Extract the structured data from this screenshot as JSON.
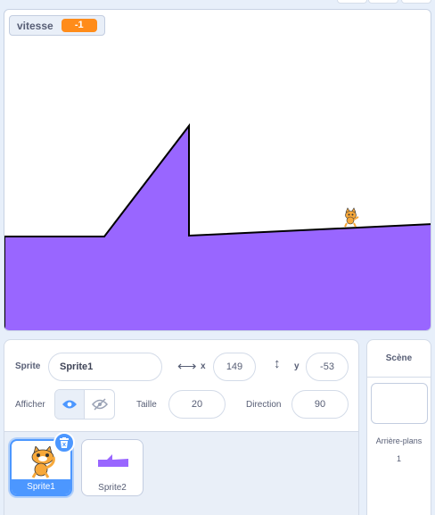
{
  "monitor": {
    "label": "vitesse",
    "value": "-1"
  },
  "sprite_info": {
    "sprite_label": "Sprite",
    "sprite_name": "Sprite1",
    "x_label": "x",
    "x_value": "149",
    "y_label": "y",
    "y_value": "-53",
    "show_label": "Afficher",
    "size_label": "Taille",
    "size_value": "20",
    "direction_label": "Direction",
    "direction_value": "90"
  },
  "sprites": [
    {
      "name": "Sprite1",
      "selected": true,
      "icon": "cat-icon"
    },
    {
      "name": "Sprite2",
      "selected": false,
      "icon": "ground-shape-icon"
    }
  ],
  "stage_panel": {
    "title": "Scène",
    "backdrops_label": "Arrière-plans",
    "backdrops_count": "1"
  },
  "colors": {
    "ground": "#9966ff",
    "monitor_value": "#ff8c1a",
    "accent": "#4c97ff"
  }
}
